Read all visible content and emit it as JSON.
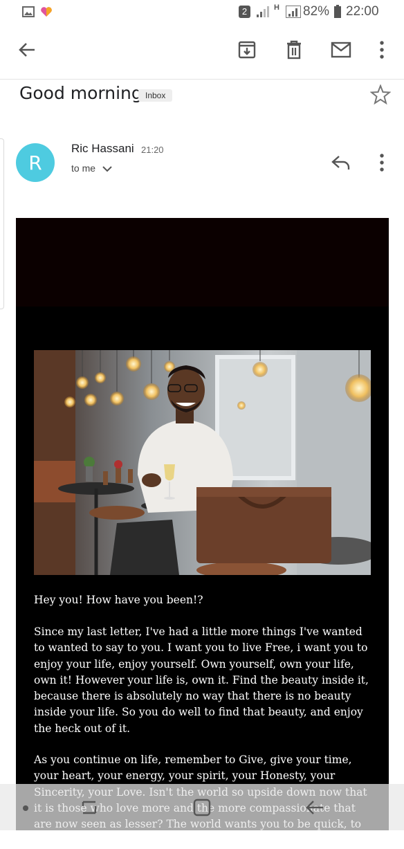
{
  "status_bar": {
    "sim_badge": "2",
    "network_type": "H",
    "battery_percent": "82%",
    "time": "22:00",
    "icons": [
      "gallery-icon",
      "heart-app-icon",
      "signal-icon",
      "battery-icon"
    ]
  },
  "toolbar": {
    "icons": [
      "back-arrow-icon",
      "archive-icon",
      "delete-icon",
      "mark-unread-icon",
      "more-vert-icon"
    ]
  },
  "email": {
    "subject": "Good morning",
    "label": "Inbox",
    "sender_initial": "R",
    "sender_name": "Ric Hassani",
    "time": "21:20",
    "recipient": "to me",
    "greeting": "Hey you! How have you been!?",
    "paragraph1": "Since my last letter, I've had a little more things I've wanted to wanted to say to you. I want you to live Free, i want you to enjoy your life, enjoy yourself. Own yourself, own your life, own it! However your life is, own it. Find the beauty inside it, because there is absolutely no way that there is no beauty inside your life. So you do well to find that beauty, and enjoy the heck out of it.",
    "paragraph2": "As you continue on life, remember to Give, give your time, your heart, your energy, your spirit, your Honesty, your Sincerity, your Love. Isn't the world so upside down now that it is those who love more and the more compassionate that are now seen as lesser? The world wants you to be quick, to be cunning, to be deceitful."
  },
  "colors": {
    "avatar": "#4ecbe0",
    "email_background": "#000000"
  },
  "nav_bar": {
    "icons": [
      "recents-icon",
      "home-icon",
      "back-nav-icon"
    ]
  }
}
